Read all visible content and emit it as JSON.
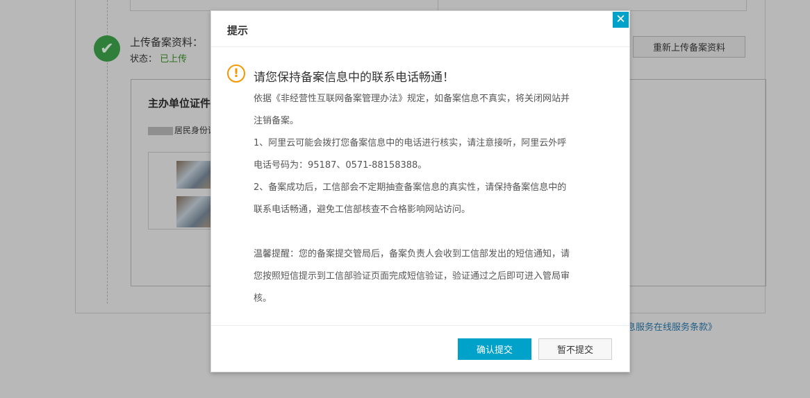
{
  "background": {
    "upload_title": "上传备案资料：",
    "status_label": "状态：",
    "status_value": "已上传",
    "reupload_button": "重新上传备案资料",
    "doc_title": "主办单位证件",
    "doc_sub": "居民身份证",
    "bottom_link": "息服务在线服务条款》"
  },
  "modal": {
    "title": "提示",
    "close_glyph": "✕",
    "warn_glyph": "!",
    "heading": "请您保持备案信息中的联系电话畅通！",
    "body_lines": [
      "依据《非经营性互联网备案管理办法》规定，如备案信息不真实，将关闭网站并",
      "注销备案。",
      "1、阿里云可能会拨打您备案信息中的电话进行核实，请注意接听，阿里云外呼",
      "电话号码为：95187、0571-88158388。",
      "2、备案成功后，工信部会不定期抽查备案信息的真实性，请保持备案信息中的",
      "联系电话畅通，避免工信部核查不合格影响网站访问。",
      "温馨提醒：您的备案提交管局后，备案负责人会收到工信部发出的短信通知，请",
      "您按照短信提示到工信部验证页面完成短信验证，验证通过之后即可进入管局审",
      "核。"
    ],
    "confirm_button": "确认提交",
    "cancel_button": "暂不提交"
  },
  "colors": {
    "accent": "#00a2ca",
    "warning": "#f39800",
    "success": "#2f7f3b"
  },
  "icons": {
    "close": "close-icon",
    "warning": "exclamation-circle-icon",
    "check": "checkmark-circle-icon"
  }
}
